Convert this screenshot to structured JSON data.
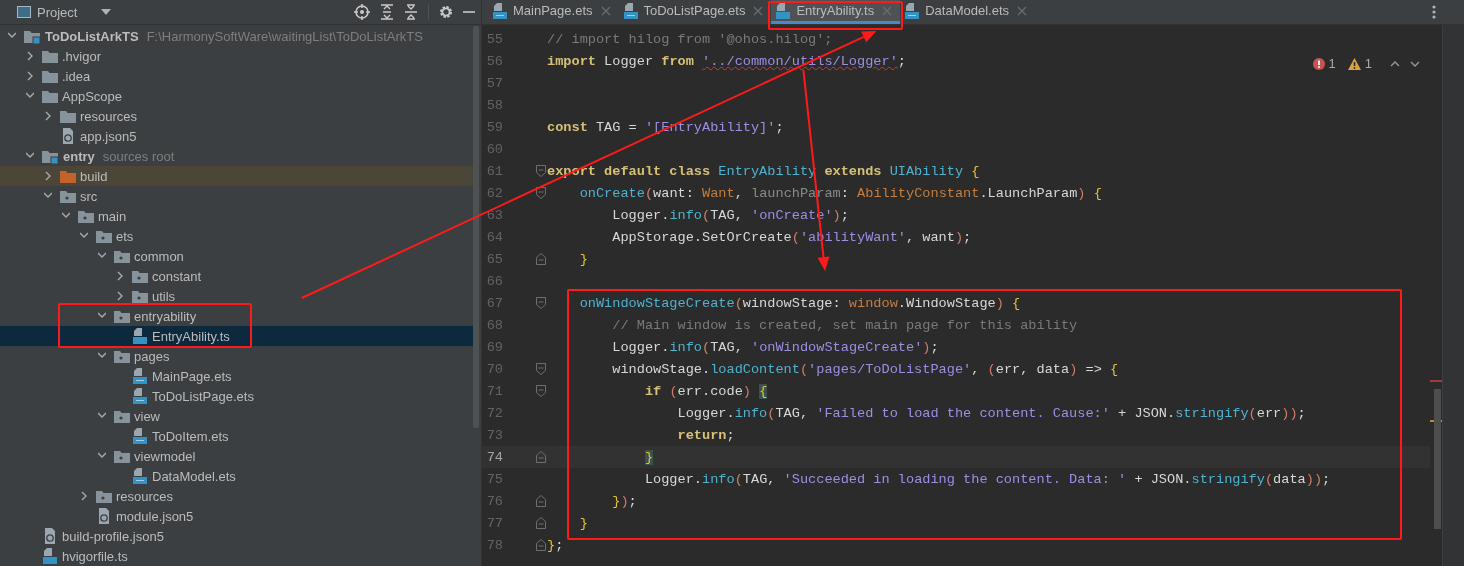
{
  "project_panel": {
    "title": "Project",
    "tree": [
      {
        "label": "ToDoListArkTS",
        "kind": "module",
        "bold": true,
        "expanded": true,
        "hint": "F:\\HarmonySoftWare\\waitingList\\ToDoListArkTS",
        "children": [
          {
            "label": ".hvigor",
            "kind": "folder",
            "expanded": false
          },
          {
            "label": ".idea",
            "kind": "folder",
            "expanded": false
          },
          {
            "label": "AppScope",
            "kind": "folder",
            "expanded": true,
            "children": [
              {
                "label": "resources",
                "kind": "folder",
                "expanded": false
              },
              {
                "label": "app.json5",
                "kind": "json"
              }
            ]
          },
          {
            "label": "entry",
            "kind": "module",
            "bold": true,
            "expanded": true,
            "hint": "sources root",
            "children": [
              {
                "label": "build",
                "kind": "excluded",
                "expanded": false
              },
              {
                "label": "src",
                "kind": "package",
                "expanded": true,
                "children": [
                  {
                    "label": "main",
                    "kind": "package",
                    "expanded": true,
                    "children": [
                      {
                        "label": "ets",
                        "kind": "package",
                        "expanded": true,
                        "children": [
                          {
                            "label": "common",
                            "kind": "package",
                            "expanded": true,
                            "children": [
                              {
                                "label": "constant",
                                "kind": "package",
                                "expanded": false
                              },
                              {
                                "label": "utils",
                                "kind": "package",
                                "expanded": false
                              }
                            ]
                          },
                          {
                            "label": "entryability",
                            "kind": "package",
                            "expanded": true,
                            "highlighted": true,
                            "children": [
                              {
                                "label": "EntryAbility.ts",
                                "kind": "ts",
                                "selected": true,
                                "highlighted": true
                              }
                            ]
                          },
                          {
                            "label": "pages",
                            "kind": "package",
                            "expanded": true,
                            "children": [
                              {
                                "label": "MainPage.ets",
                                "kind": "ets"
                              },
                              {
                                "label": "ToDoListPage.ets",
                                "kind": "ets"
                              }
                            ]
                          },
                          {
                            "label": "view",
                            "kind": "package",
                            "expanded": true,
                            "children": [
                              {
                                "label": "ToDoItem.ets",
                                "kind": "ets"
                              }
                            ]
                          },
                          {
                            "label": "viewmodel",
                            "kind": "package",
                            "expanded": true,
                            "children": [
                              {
                                "label": "DataModel.ets",
                                "kind": "ets"
                              }
                            ]
                          }
                        ]
                      },
                      {
                        "label": "resources",
                        "kind": "package",
                        "expanded": false
                      },
                      {
                        "label": "module.json5",
                        "kind": "json"
                      }
                    ]
                  }
                ]
              }
            ]
          },
          {
            "label": "build-profile.json5",
            "kind": "json"
          },
          {
            "label": "hvigorfile.ts",
            "kind": "ts"
          }
        ]
      }
    ]
  },
  "tabs": [
    {
      "label": "MainPage.ets",
      "kind": "ets",
      "selected": false
    },
    {
      "label": "ToDoListPage.ets",
      "kind": "ets",
      "selected": false
    },
    {
      "label": "EntryAbility.ts",
      "kind": "ts",
      "selected": true,
      "highlighted": true
    },
    {
      "label": "DataModel.ets",
      "kind": "ets",
      "selected": false
    }
  ],
  "inspections": {
    "errors": "1",
    "warnings": "1"
  },
  "code": [
    {
      "lines": [
        {
          "num": "55",
          "kind": "plain",
          "tokens": [
            {
              "kind": "cm",
              "text": "// import hilog from '@ohos.hilog';"
            }
          ]
        },
        {
          "num": "56",
          "kind": "plain",
          "tokens": [
            {
              "kind": "kw",
              "text": "import"
            },
            {
              "kind": "tx",
              "text": " Logger "
            },
            {
              "kind": "kw",
              "text": "from "
            },
            {
              "kind": "str",
              "text": "'../common/utils/Logger'",
              "squiggle": true
            },
            {
              "kind": "tx",
              "text": ";"
            }
          ]
        },
        {
          "num": "57",
          "kind": "plain"
        },
        {
          "num": "58",
          "kind": "plain"
        },
        {
          "num": "59",
          "kind": "plain",
          "tokens": [
            {
              "kind": "kw",
              "text": "const"
            },
            {
              "kind": "tx",
              "text": " TAG = "
            },
            {
              "kind": "str",
              "text": "'[EntryAbility]'"
            },
            {
              "kind": "tx",
              "text": ";"
            }
          ]
        },
        {
          "num": "60",
          "kind": "plain"
        },
        {
          "num": "61",
          "kind": "fold-start",
          "tokens": [
            {
              "kind": "kw",
              "text": "export default class "
            },
            {
              "kind": "fn",
              "text": "EntryAbility "
            },
            {
              "kind": "kw",
              "text": "extends "
            },
            {
              "kind": "fn",
              "text": "UIAbility "
            },
            {
              "kind": "br",
              "text": "{"
            }
          ]
        },
        {
          "num": "62",
          "kind": "fold-start",
          "tokens": [
            {
              "kind": "fn",
              "text": "    onCreate"
            },
            {
              "kind": "pa",
              "text": "("
            },
            {
              "kind": "tx",
              "text": "want: "
            },
            {
              "kind": "type",
              "text": "Want"
            },
            {
              "kind": "tx",
              "text": ", "
            },
            {
              "kind": "param",
              "text": "launchParam"
            },
            {
              "kind": "tx",
              "text": ": "
            },
            {
              "kind": "type",
              "text": "AbilityConstant"
            },
            {
              "kind": "tx",
              "text": ".LaunchParam"
            },
            {
              "kind": "pa",
              "text": ") "
            },
            {
              "kind": "br",
              "text": "{"
            }
          ]
        },
        {
          "num": "63",
          "kind": "plain",
          "tokens": [
            {
              "kind": "tx",
              "text": "        Logger."
            },
            {
              "kind": "fn",
              "text": "info"
            },
            {
              "kind": "pa",
              "text": "("
            },
            {
              "kind": "tx",
              "text": "TAG, "
            },
            {
              "kind": "str",
              "text": "'onCreate'"
            },
            {
              "kind": "pa",
              "text": ")"
            },
            {
              "kind": "tx",
              "text": ";"
            }
          ]
        },
        {
          "num": "64",
          "kind": "plain",
          "tokens": [
            {
              "kind": "tx",
              "text": "        AppStorage.SetOrCreate"
            },
            {
              "kind": "pa",
              "text": "("
            },
            {
              "kind": "str",
              "text": "'abilityWant'"
            },
            {
              "kind": "tx",
              "text": ", want"
            },
            {
              "kind": "pa",
              "text": ")"
            },
            {
              "kind": "tx",
              "text": ";"
            }
          ]
        },
        {
          "num": "65",
          "kind": "fold-end",
          "tokens": [
            {
              "kind": "br",
              "text": "    }"
            }
          ]
        },
        {
          "num": "66",
          "kind": "plain"
        }
      ]
    },
    {
      "highlighted": true,
      "lines": [
        {
          "num": "67",
          "kind": "fold-start",
          "tokens": [
            {
              "kind": "fn",
              "text": "    onWindowStageCreate"
            },
            {
              "kind": "pa",
              "text": "("
            },
            {
              "kind": "tx",
              "text": "windowStage: "
            },
            {
              "kind": "type",
              "text": "window"
            },
            {
              "kind": "tx",
              "text": ".WindowStage"
            },
            {
              "kind": "pa",
              "text": ") "
            },
            {
              "kind": "br",
              "text": "{"
            }
          ]
        },
        {
          "num": "68",
          "kind": "plain",
          "tokens": [
            {
              "kind": "cm",
              "text": "        // Main window is created, set main page for this ability"
            }
          ]
        },
        {
          "num": "69",
          "kind": "plain",
          "tokens": [
            {
              "kind": "tx",
              "text": "        Logger."
            },
            {
              "kind": "fn",
              "text": "info"
            },
            {
              "kind": "pa",
              "text": "("
            },
            {
              "kind": "tx",
              "text": "TAG, "
            },
            {
              "kind": "str",
              "text": "'onWindowStageCreate'"
            },
            {
              "kind": "pa",
              "text": ")"
            },
            {
              "kind": "tx",
              "text": ";"
            }
          ]
        },
        {
          "num": "70",
          "kind": "fold-start",
          "tokens": [
            {
              "kind": "tx",
              "text": "        windowStage."
            },
            {
              "kind": "fn",
              "text": "loadContent"
            },
            {
              "kind": "pa",
              "text": "("
            },
            {
              "kind": "str",
              "text": "'pages/ToDoListPage'"
            },
            {
              "kind": "tx",
              "text": ", "
            },
            {
              "kind": "pa",
              "text": "("
            },
            {
              "kind": "tx",
              "text": "err, data"
            },
            {
              "kind": "pa",
              "text": ")"
            },
            {
              "kind": "tx",
              "text": " => "
            },
            {
              "kind": "br",
              "text": "{"
            }
          ]
        },
        {
          "num": "71",
          "kind": "fold-start",
          "tokens": [
            {
              "kind": "kw",
              "text": "            if "
            },
            {
              "kind": "pa",
              "text": "("
            },
            {
              "kind": "tx",
              "text": "err.code"
            },
            {
              "kind": "pa",
              "text": ") "
            },
            {
              "kind": "br",
              "text": "{",
              "matched": true
            }
          ]
        },
        {
          "num": "72",
          "kind": "plain",
          "tokens": [
            {
              "kind": "tx",
              "text": "                Logger."
            },
            {
              "kind": "fn",
              "text": "info"
            },
            {
              "kind": "pa",
              "text": "("
            },
            {
              "kind": "tx",
              "text": "TAG, "
            },
            {
              "kind": "str",
              "text": "'Failed to load the content. Cause:'"
            },
            {
              "kind": "tx",
              "text": " + JSON."
            },
            {
              "kind": "fn",
              "text": "stringify"
            },
            {
              "kind": "pa",
              "text": "("
            },
            {
              "kind": "tx",
              "text": "err"
            },
            {
              "kind": "pa",
              "text": "))"
            },
            {
              "kind": "tx",
              "text": ";"
            }
          ]
        },
        {
          "num": "73",
          "kind": "plain",
          "tokens": [
            {
              "kind": "kw",
              "text": "                return"
            },
            {
              "kind": "tx",
              "text": ";"
            }
          ]
        },
        {
          "num": "74",
          "kind": "fold-end",
          "current": true,
          "tokens": [
            {
              "kind": "br",
              "text": "            }",
              "matched": true
            }
          ]
        },
        {
          "num": "75",
          "kind": "plain",
          "tokens": [
            {
              "kind": "tx",
              "text": "            Logger."
            },
            {
              "kind": "fn",
              "text": "info"
            },
            {
              "kind": "pa",
              "text": "("
            },
            {
              "kind": "tx",
              "text": "TAG, "
            },
            {
              "kind": "str",
              "text": "'Succeeded in loading the content. Data: '"
            },
            {
              "kind": "tx",
              "text": " + JSON."
            },
            {
              "kind": "fn",
              "text": "stringify"
            },
            {
              "kind": "pa",
              "text": "("
            },
            {
              "kind": "tx",
              "text": "data"
            },
            {
              "kind": "pa",
              "text": "))"
            },
            {
              "kind": "tx",
              "text": ";"
            }
          ]
        },
        {
          "num": "76",
          "kind": "fold-end",
          "tokens": [
            {
              "kind": "br",
              "text": "        }"
            },
            {
              "kind": "pa",
              "text": ")"
            },
            {
              "kind": "tx",
              "text": ";"
            }
          ]
        },
        {
          "num": "77",
          "kind": "fold-end",
          "tokens": [
            {
              "kind": "br",
              "text": "    }"
            }
          ]
        }
      ]
    },
    {
      "lines": [
        {
          "num": "78",
          "kind": "fold-end",
          "tokens": [
            {
              "kind": "br",
              "text": "}"
            },
            {
              "kind": "tx",
              "text": ";"
            }
          ]
        }
      ]
    }
  ]
}
